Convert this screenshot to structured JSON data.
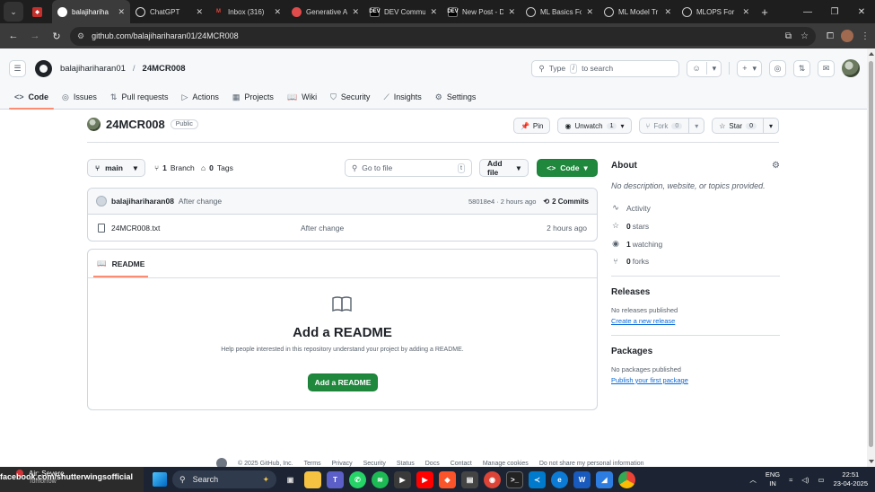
{
  "browser": {
    "tabs": [
      {
        "title": "",
        "icon": "red-app-icon",
        "color": "#c4302b"
      },
      {
        "title": "balajihariha",
        "icon": "github-icon",
        "color": "#ffffff",
        "active": true
      },
      {
        "title": "ChatGPT",
        "icon": "chatgpt-icon",
        "color": "#ffffff"
      },
      {
        "title": "Inbox (316)",
        "icon": "gmail-icon",
        "color": "#ea4335"
      },
      {
        "title": "Generative A",
        "icon": "generative-icon",
        "color": "#e04b4b"
      },
      {
        "title": "DEV Commu",
        "icon": "dev-icon",
        "color": "#000000"
      },
      {
        "title": "New Post - D",
        "icon": "dev-icon",
        "color": "#000000"
      },
      {
        "title": "ML Basics Fo",
        "icon": "medium-icon",
        "color": "#444444"
      },
      {
        "title": "ML Model Tr",
        "icon": "medium-icon",
        "color": "#444444"
      },
      {
        "title": "MLOPS For",
        "icon": "medium-icon",
        "color": "#444444"
      }
    ],
    "url": "github.com/balajihariharan01/24MCR008"
  },
  "header": {
    "owner": "balajihariharan01",
    "repo": "24MCR008",
    "search_prefix": "Type",
    "search_key": "/",
    "search_suffix": "to search"
  },
  "nav": [
    {
      "label": "Code",
      "icon": "code-icon",
      "active": true
    },
    {
      "label": "Issues",
      "icon": "issues-icon"
    },
    {
      "label": "Pull requests",
      "icon": "pull-request-icon"
    },
    {
      "label": "Actions",
      "icon": "actions-icon"
    },
    {
      "label": "Projects",
      "icon": "projects-icon"
    },
    {
      "label": "Wiki",
      "icon": "wiki-icon"
    },
    {
      "label": "Security",
      "icon": "shield-icon"
    },
    {
      "label": "Insights",
      "icon": "graph-icon"
    },
    {
      "label": "Settings",
      "icon": "gear-icon"
    }
  ],
  "repo": {
    "name": "24MCR008",
    "visibility": "Public",
    "pin_label": "Pin",
    "unwatch_label": "Unwatch",
    "watch_count": "1",
    "fork_label": "Fork",
    "fork_count": "0",
    "star_label": "Star",
    "star_count": "0"
  },
  "files": {
    "branch": "main",
    "branch_count": "1",
    "branch_label": "Branch",
    "tag_count": "0",
    "tag_label": "Tags",
    "goto_placeholder": "Go to file",
    "goto_key": "t",
    "add_file_label": "Add file",
    "code_label": "Code",
    "commit_user": "balajihariharan08",
    "commit_message": "After change",
    "commit_hash": "58018e4",
    "commit_time": "· 2 hours ago",
    "commit_count": "2 Commits",
    "rows": [
      {
        "name": "24MCR008.txt",
        "message": "After change",
        "time": "2 hours ago"
      }
    ]
  },
  "readme": {
    "tab_label": "README",
    "heading": "Add a README",
    "text": "Help people interested in this repository understand your project by adding a README.",
    "button": "Add a README"
  },
  "about": {
    "title": "About",
    "description": "No description, website, or topics provided.",
    "activity": "Activity",
    "stars_count": "0",
    "stars_label": "stars",
    "watching_count": "1",
    "watching_label": "watching",
    "forks_count": "0",
    "forks_label": "forks"
  },
  "releases": {
    "title": "Releases",
    "empty": "No releases published",
    "link": "Create a new release"
  },
  "packages": {
    "title": "Packages",
    "empty": "No packages published",
    "link": "Publish your first package"
  },
  "footer": {
    "copyright": "© 2025 GitHub, Inc.",
    "links": [
      "Terms",
      "Privacy",
      "Security",
      "Status",
      "Docs",
      "Contact",
      "Manage cookies",
      "Do not share my personal information"
    ]
  },
  "taskbar": {
    "weather_title": "Air: Severe",
    "weather_sub": "Tomorrow",
    "overlay_text": "facebook.com/shutterwingsofficial",
    "search_label": "Search",
    "lang_top": "ENG",
    "lang_bottom": "IN",
    "time": "22:51",
    "date": "23-04-2025"
  },
  "colors": {
    "accent_green": "#1f883d",
    "nav_underline": "#fd8c73",
    "link_blue": "#0969da"
  }
}
